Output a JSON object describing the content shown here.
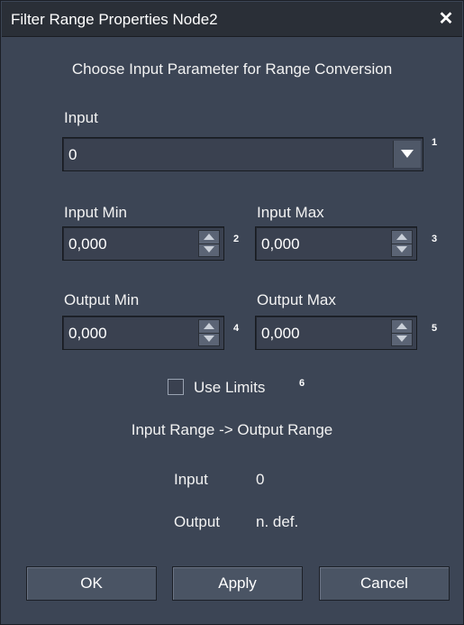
{
  "window": {
    "title": "Filter Range Properties Node2",
    "close_icon": "close-icon"
  },
  "heading": "Choose Input Parameter for Range Conversion",
  "input": {
    "label": "Input",
    "value": "0",
    "marker": "1"
  },
  "input_min": {
    "label": "Input Min",
    "value": "0,000",
    "marker": "2"
  },
  "input_max": {
    "label": "Input Max",
    "value": "0,000",
    "marker": "3"
  },
  "output_min": {
    "label": "Output Min",
    "value": "0,000",
    "marker": "4"
  },
  "output_max": {
    "label": "Output Max",
    "value": "0,000",
    "marker": "5"
  },
  "use_limits": {
    "label": "Use Limits",
    "checked": false,
    "marker": "6"
  },
  "range_title": "Input Range -> Output Range",
  "readout": {
    "input_label": "Input",
    "input_value": "0",
    "output_label": "Output",
    "output_value": "n. def."
  },
  "buttons": {
    "ok": "OK",
    "apply": "Apply",
    "cancel": "Cancel"
  }
}
